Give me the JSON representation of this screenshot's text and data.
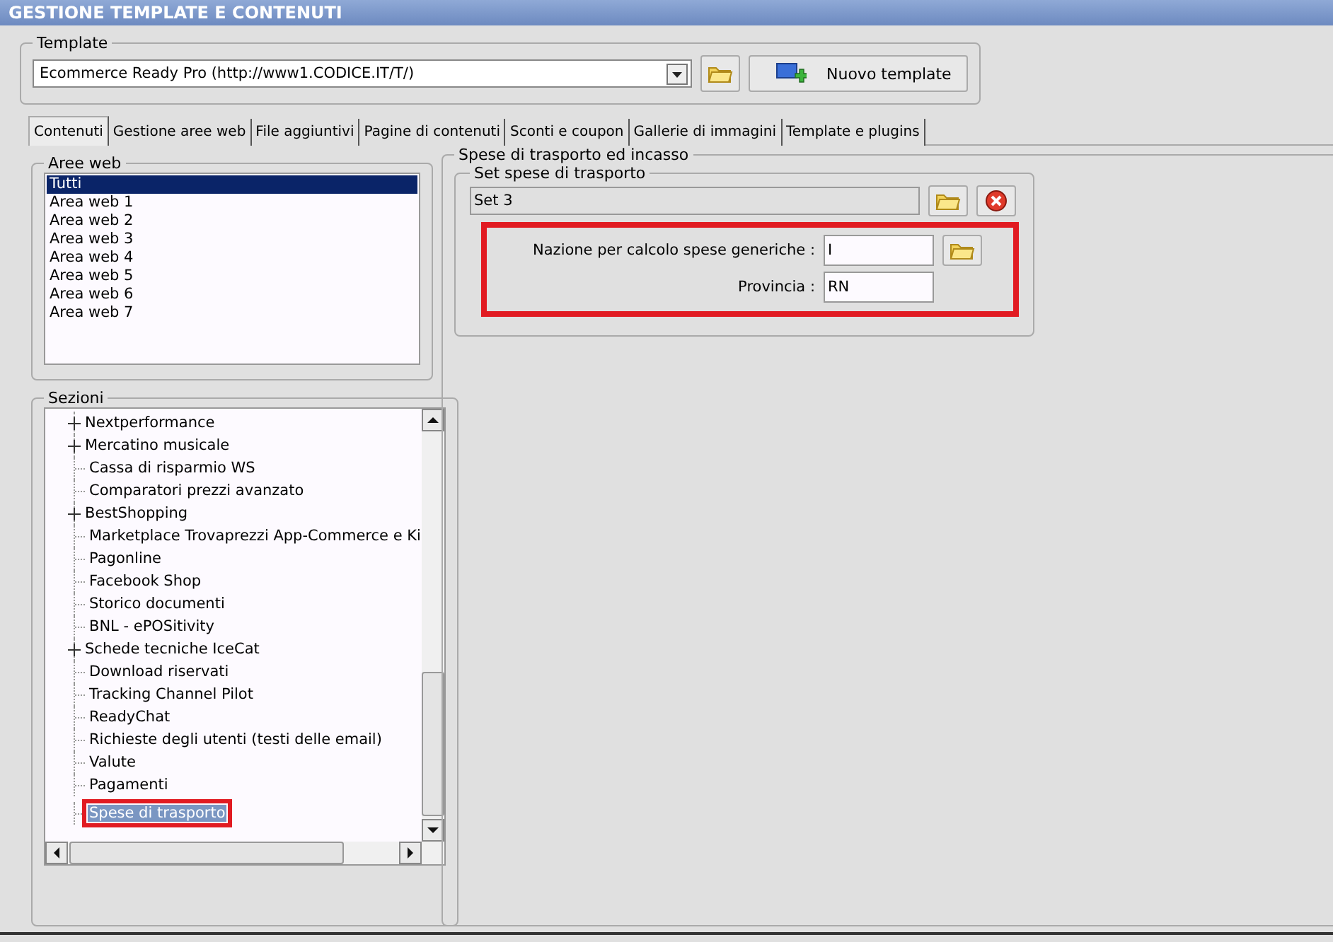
{
  "window": {
    "title": "GESTIONE TEMPLATE E CONTENUTI"
  },
  "template": {
    "legend": "Template",
    "value": "Ecommerce Ready Pro (http://www1.CODICE.IT/T/)",
    "new_button": "Nuovo template"
  },
  "tabs": [
    {
      "label": "Contenuti",
      "selected": true
    },
    {
      "label": "Gestione aree web",
      "selected": false
    },
    {
      "label": "File aggiuntivi",
      "selected": false
    },
    {
      "label": "Pagine di contenuti",
      "selected": false
    },
    {
      "label": "Sconti e coupon",
      "selected": false
    },
    {
      "label": "Gallerie di immagini",
      "selected": false
    },
    {
      "label": "Template e plugins",
      "selected": false
    }
  ],
  "web_areas": {
    "legend": "Aree web",
    "items": [
      {
        "label": "Tutti",
        "selected": true
      },
      {
        "label": "Area web 1",
        "selected": false
      },
      {
        "label": "Area web 2",
        "selected": false
      },
      {
        "label": "Area web 3",
        "selected": false
      },
      {
        "label": "Area web 4",
        "selected": false
      },
      {
        "label": "Area web 5",
        "selected": false
      },
      {
        "label": "Area web 6",
        "selected": false
      },
      {
        "label": "Area web 7",
        "selected": false
      }
    ]
  },
  "sections": {
    "legend": "Sezioni",
    "items": [
      {
        "label": "Nextperformance",
        "kind": "group",
        "selected": false
      },
      {
        "label": "Mercatino musicale",
        "kind": "group",
        "selected": false
      },
      {
        "label": "Cassa di risparmio WS",
        "kind": "leaf",
        "selected": false
      },
      {
        "label": "Comparatori prezzi avanzato",
        "kind": "leaf",
        "selected": false
      },
      {
        "label": "BestShopping",
        "kind": "group",
        "selected": false
      },
      {
        "label": "Marketplace Trovaprezzi App-Commerce e Ki",
        "kind": "leaf",
        "selected": false
      },
      {
        "label": "Pagonline",
        "kind": "leaf",
        "selected": false
      },
      {
        "label": "Facebook Shop",
        "kind": "leaf",
        "selected": false
      },
      {
        "label": "Storico documenti",
        "kind": "leaf",
        "selected": false
      },
      {
        "label": "BNL - ePOSitivity",
        "kind": "leaf",
        "selected": false
      },
      {
        "label": "Schede tecniche IceCat",
        "kind": "group",
        "selected": false
      },
      {
        "label": "Download riservati",
        "kind": "leaf",
        "selected": false
      },
      {
        "label": "Tracking Channel Pilot",
        "kind": "leaf",
        "selected": false
      },
      {
        "label": "ReadyChat",
        "kind": "leaf",
        "selected": false
      },
      {
        "label": "Richieste degli utenti (testi delle email)",
        "kind": "leaf",
        "selected": false
      },
      {
        "label": "Valute",
        "kind": "leaf",
        "selected": false
      },
      {
        "label": "Pagamenti",
        "kind": "leaf",
        "selected": false
      },
      {
        "label": "Spese di trasporto",
        "kind": "leaf",
        "selected": true
      }
    ]
  },
  "shipping": {
    "legend": "Spese di trasporto ed incasso",
    "set_legend": "Set spese di trasporto",
    "set_value": "Set 3",
    "fields": [
      {
        "label": "Nazione per calcolo spese generiche :",
        "value": "I",
        "kind": "lookup"
      },
      {
        "label": "Provincia :",
        "value": "RN",
        "kind": "plain"
      }
    ]
  }
}
